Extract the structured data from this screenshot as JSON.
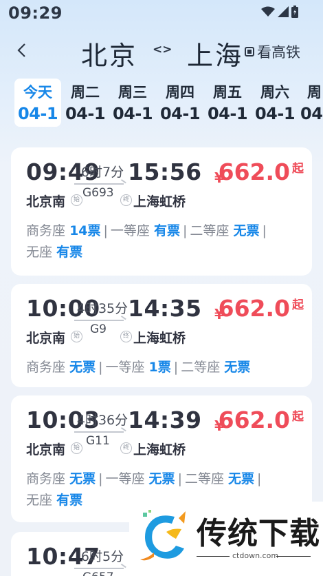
{
  "status_bar": {
    "time": "09:29",
    "icons": [
      "wifi-icon",
      "signal-icon",
      "battery-icon"
    ]
  },
  "header": {
    "from_city": "北京",
    "swap_symbol": "<>",
    "to_city": "上海",
    "high_speed_label": "看高铁"
  },
  "dates": [
    {
      "day": "今天",
      "date": "04-1",
      "selected": true
    },
    {
      "day": "周二",
      "date": "04-1",
      "selected": false
    },
    {
      "day": "周三",
      "date": "04-1",
      "selected": false
    },
    {
      "day": "周四",
      "date": "04-1",
      "selected": false
    },
    {
      "day": "周五",
      "date": "04-1",
      "selected": false
    },
    {
      "day": "周六",
      "date": "04-1",
      "selected": false
    },
    {
      "day": "周",
      "date": "04-",
      "selected": false
    }
  ],
  "trains": [
    {
      "depart": "09:49",
      "duration": "6时7分",
      "train_no": "G693",
      "arrive": "15:56",
      "from_station": "北京南",
      "to_station": "上海虹桥",
      "currency": "¥",
      "price": "662.0",
      "price_suffix": "起",
      "start_tag": "始",
      "end_tag": "终",
      "seats": [
        {
          "name": "商务座",
          "value": "14票"
        },
        {
          "name": "一等座",
          "value": "有票"
        },
        {
          "name": "二等座",
          "value": "无票"
        },
        {
          "name": "无座",
          "value": "有票"
        }
      ]
    },
    {
      "depart": "10:00",
      "duration": "4时35分",
      "train_no": "G9",
      "arrive": "14:35",
      "from_station": "北京南",
      "to_station": "上海虹桥",
      "currency": "¥",
      "price": "662.0",
      "price_suffix": "起",
      "start_tag": "始",
      "end_tag": "终",
      "seats": [
        {
          "name": "商务座",
          "value": "无票"
        },
        {
          "name": "一等座",
          "value": "1票"
        },
        {
          "name": "二等座",
          "value": "无票"
        }
      ]
    },
    {
      "depart": "10:03",
      "duration": "4时36分",
      "train_no": "G11",
      "arrive": "14:39",
      "from_station": "北京南",
      "to_station": "上海虹桥",
      "currency": "¥",
      "price": "662.0",
      "price_suffix": "起",
      "start_tag": "始",
      "end_tag": "终",
      "seats": [
        {
          "name": "商务座",
          "value": "无票"
        },
        {
          "name": "一等座",
          "value": "无票"
        },
        {
          "name": "二等座",
          "value": "无票"
        },
        {
          "name": "无座",
          "value": "有票"
        }
      ]
    },
    {
      "depart": "10:47",
      "duration": "6时5分",
      "train_no": "G657",
      "partial": true
    }
  ],
  "watermark": {
    "title": "传统下载",
    "url": "ctdown.com"
  },
  "colors": {
    "accent": "#1787e8",
    "price": "#ef4c59"
  }
}
